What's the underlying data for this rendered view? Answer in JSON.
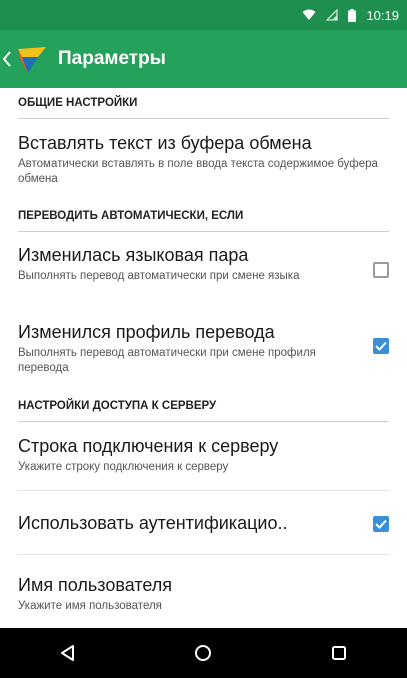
{
  "status_bar": {
    "time": "10:19"
  },
  "app_bar": {
    "title": "Параметры"
  },
  "sections": [
    {
      "title": "ОБЩИЕ НАСТРОЙКИ"
    },
    {
      "title": "ПЕРЕВОДИТЬ АВТОМАТИЧЕСКИ, ЕСЛИ"
    },
    {
      "title": "НАСТРОЙКИ ДОСТУПА К СЕРВЕРУ"
    }
  ],
  "prefs": [
    {
      "title": "Вставлять текст из буфера обмена",
      "summary": "Автоматически вставлять в поле ввода текста содержимое буфера обмена"
    },
    {
      "title": "Изменилась языковая пара",
      "summary": "Выполнять перевод автоматически при смене языка",
      "checked": false
    },
    {
      "title": "Изменился профиль перевода",
      "summary": "Выполнять перевод автоматически при смене профиля перевода",
      "checked": true
    },
    {
      "title": "Строка подключения к серверу",
      "summary": "Укажите строку подключения к серверу"
    },
    {
      "title": "Использовать аутентификацио..",
      "checked": true
    },
    {
      "title": "Имя пользователя",
      "summary": "Укажите имя пользователя"
    }
  ],
  "colors": {
    "status_bar": "#1f8f4f",
    "app_bar": "#24a15a",
    "checkbox_on": "#3a8fd6"
  },
  "icons": {
    "status": [
      "wifi-icon",
      "signal-icon",
      "battery-icon"
    ],
    "nav": [
      "back-triangle-icon",
      "home-circle-icon",
      "recents-square-icon"
    ]
  }
}
